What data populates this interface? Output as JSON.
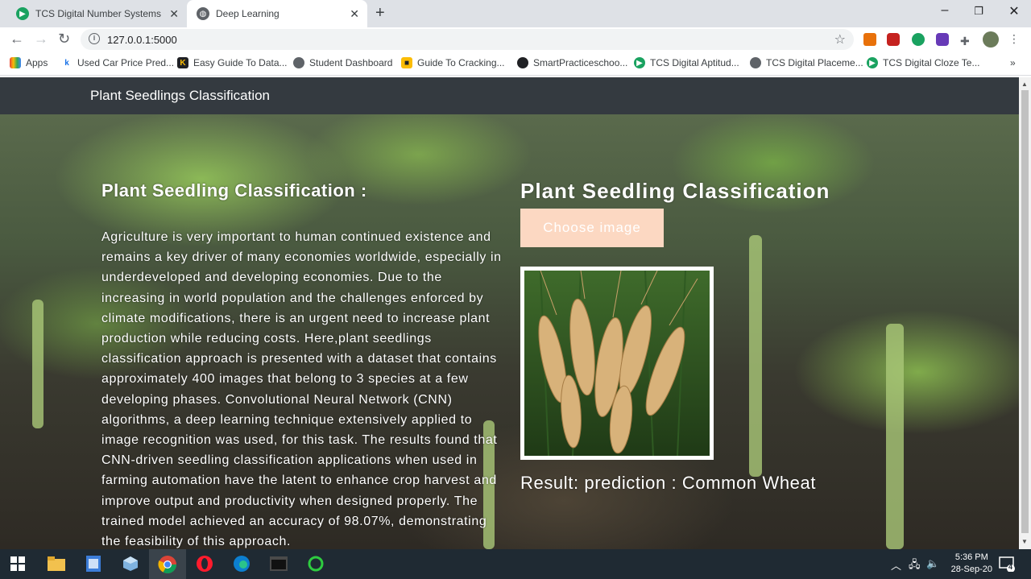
{
  "browser": {
    "tabs": [
      {
        "title": "TCS Digital Number Systems Quiz",
        "active": false
      },
      {
        "title": "Deep Learning",
        "active": true
      }
    ],
    "url": "127.0.0.1:5000",
    "bookmarks": [
      "Apps",
      "Used Car Price Pred...",
      "Easy Guide To Data...",
      "Student Dashboard",
      "Guide To Cracking...",
      "SmartPracticeschoo...",
      "TCS Digital Aptitud...",
      "TCS Digital Placeme...",
      "TCS Digital Cloze Te..."
    ],
    "more_bookmarks": "»"
  },
  "navbar": {
    "brand": "Plant Seedlings Classification"
  },
  "main": {
    "left_title": "Plant Seedling Classification :",
    "description": "Agriculture is very important to human continued existence and remains a key driver of many economies worldwide, especially in underdeveloped and developing economies. Due to the increasing in world population and the challenges enforced by climate modifications, there is an urgent need to increase plant production while reducing costs. Here,plant seedlings classification approach is presented with a dataset that contains approximately 400 images that belong to 3 species at a few developing phases. Convolutional Neural Network (CNN) algorithms, a deep learning technique extensively applied to image recognition was used, for this task. The results found that CNN-driven seedling classification applications when used in farming automation have the latent to enhance crop harvest and improve output and productivity when designed properly. The trained model achieved an accuracy of 98.07%, demonstrating the feasibility of this approach.",
    "right_title": "Plant Seedling Classification",
    "choose_label": "Choose image",
    "result": "Result: prediction : Common Wheat"
  },
  "taskbar": {
    "time": "5:36 PM",
    "date": "28-Sep-20",
    "notifications": "4"
  },
  "colors": {
    "navbar": "#343a40",
    "choose_button": "#fcd8c2"
  }
}
